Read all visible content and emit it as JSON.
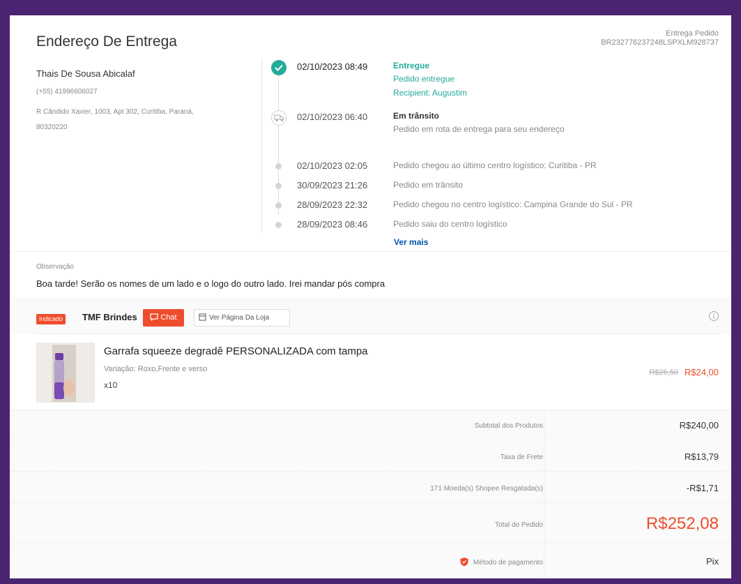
{
  "address": {
    "title": "Endereço De Entrega",
    "order_ref_label": "Entrega Pedido",
    "order_ref_code": "BR232776237248LSPXLM928737",
    "name": "Thais De Sousa Abicalaf",
    "phone": "(+55) 41996606027",
    "street": "R Cândido Xavier, 1003, Apt 302, Curitiba, Paraná,",
    "zip": "80320220"
  },
  "timeline": {
    "events": [
      {
        "time": "02/10/2023 08:49",
        "status": "Entregue",
        "desc": "Pedido entregue",
        "desc2": "Recipient: Augustim"
      },
      {
        "time": "02/10/2023 06:40",
        "status": "Em trânsito",
        "desc": "Pedido em rota de entrega para seu endereço"
      },
      {
        "time": "02/10/2023 02:05",
        "desc": "Pedido chegou ao último centro logístico: Curitiba - PR"
      },
      {
        "time": "30/09/2023 21:26",
        "desc": "Pedido em trânsito"
      },
      {
        "time": "28/09/2023 22:32",
        "desc": "Pedido chegou no centro logístico: Campina Grande do Sul - PR"
      },
      {
        "time": "28/09/2023 08:46",
        "desc": "Pedido saiu do centro logístico"
      }
    ],
    "more_label": "Ver mais"
  },
  "observation": {
    "label": "Observação",
    "text": "Boa tarde! Serão os nomes de um lado e o logo do outro lado. Irei mandar pós compra"
  },
  "shop": {
    "badge": "Indicado",
    "name": "TMF Brindes",
    "chat_label": "Chat",
    "view_label": "Ver Página Da Loja",
    "info_glyph": "i"
  },
  "product": {
    "name": "Garrafa squeeze degradê PERSONALIZADA com tampa",
    "variation": "Variação: Roxo,Frente e verso",
    "qty": "x10",
    "price_old": "R$26,50",
    "price_new": "R$24,00"
  },
  "summary": {
    "rows": [
      {
        "label": "Subtotal dos Produtos",
        "value": "R$240,00"
      },
      {
        "label": "Taxa de Frete",
        "value": "R$13,79"
      },
      {
        "label": "171 Moeda(s) Shopee Resgatada(s)",
        "value": "-R$1,71"
      },
      {
        "label": "Total do Pedido",
        "value": "R$252,08"
      },
      {
        "label": "Método de pagamento",
        "value": "Pix"
      }
    ]
  },
  "colors": {
    "accent": "#ee4d2d",
    "success": "#26aa99",
    "link": "#0055aa",
    "frame": "#4a2470"
  }
}
